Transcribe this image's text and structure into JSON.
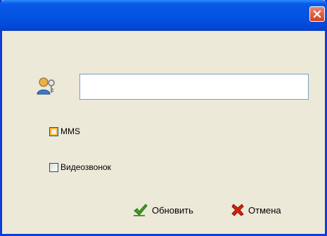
{
  "window": {
    "title": "",
    "close_icon": "close-icon"
  },
  "form": {
    "user_icon": "user-key-icon",
    "input_value": "",
    "input_placeholder": ""
  },
  "options": {
    "mms_label": "MMS",
    "mms_checked": false,
    "video_label": "Видеозвонок",
    "video_checked": false
  },
  "buttons": {
    "update_label": "Обновить",
    "update_icon": "checkmark-icon",
    "cancel_label": "Отмена",
    "cancel_icon": "cross-icon"
  },
  "colors": {
    "titlebar": "#0454e3",
    "dialog_bg": "#ece9d8",
    "close_button": "#d3421f",
    "check_icon": "#3aa31c",
    "cancel_icon": "#d81f0d"
  }
}
